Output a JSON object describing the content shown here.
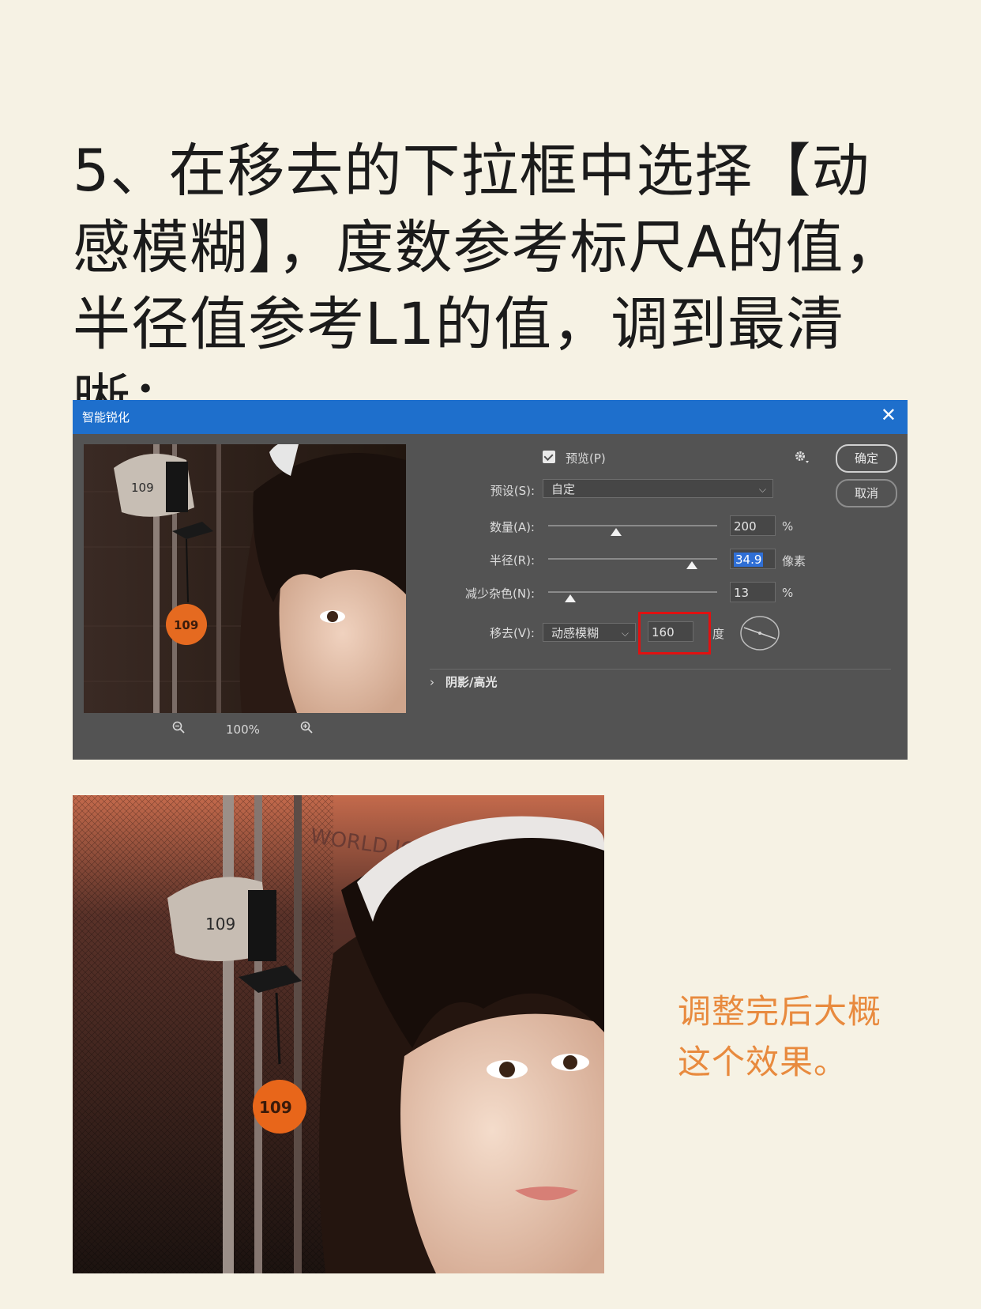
{
  "heading": "5、在移去的下拉框中选择【动感模糊】，度数参考标尺A的值，半径值参考L1的值，调到最清晰；",
  "dialog": {
    "title": "智能锐化",
    "close": "✕",
    "preview_label": "预览(P)",
    "ok_label": "确定",
    "cancel_label": "取消",
    "preset_label": "预设(S):",
    "preset_value": "自定",
    "amount_label": "数量(A):",
    "amount_value": "200",
    "amount_unit": "%",
    "amount_level": 0.4,
    "radius_label": "半径(R):",
    "radius_value": "34.9",
    "radius_unit": "像素",
    "radius_level": 0.85,
    "noise_label": "减少杂色(N):",
    "noise_value": "13",
    "noise_unit": "%",
    "noise_level": 0.13,
    "remove_label": "移去(V):",
    "remove_value": "动感模糊",
    "angle_value": "160",
    "angle_unit": "度",
    "shadow_highlight_label": "阴影/高光",
    "zoom_value": "100%",
    "photo_tag_number": "109"
  },
  "result": {
    "tag_number": "109",
    "sign_text": "WORLD ICE ARENA"
  },
  "caption": "调整完后大概这个效果。",
  "colors": {
    "background": "#f6f2e4",
    "titlebar": "#1e6fcc",
    "dialog_bg": "#535353",
    "highlight": "#e01111",
    "caption": "#e88a3e"
  }
}
